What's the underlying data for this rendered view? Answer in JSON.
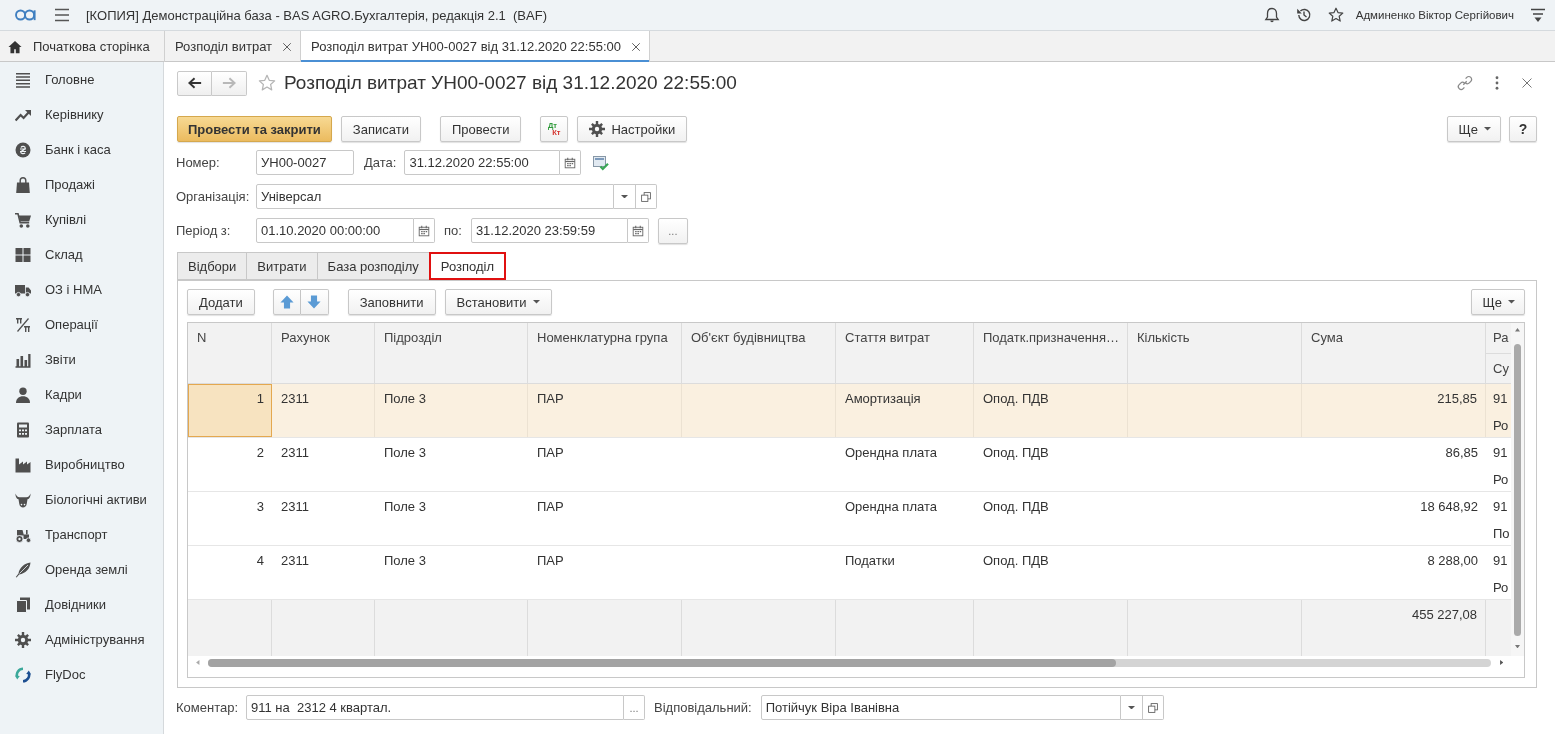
{
  "app_bar": {
    "title": "[КОПИЯ] Демонстраційна база - BAS AGRO.Бухгалтерія, редакція 2.1  (BAF)",
    "user": "Админенко Віктор Сергійович"
  },
  "open_tabs": [
    {
      "label": "Початкова сторінка",
      "kind": "home",
      "selected": false
    },
    {
      "label": "Розподіл витрат",
      "kind": "document",
      "selected": false
    },
    {
      "label": "Розподіл витрат УН00-0027 від 31.12.2020 22:55:00",
      "kind": "document",
      "selected": true
    }
  ],
  "sidebar": {
    "items": [
      {
        "label": "Головне"
      },
      {
        "label": "Керівнику"
      },
      {
        "label": "Банк і каса"
      },
      {
        "label": "Продажі"
      },
      {
        "label": "Купівлі"
      },
      {
        "label": "Склад"
      },
      {
        "label": "ОЗ і НМА"
      },
      {
        "label": "Операції"
      },
      {
        "label": "Звіти"
      },
      {
        "label": "Кадри"
      },
      {
        "label": "Зарплата"
      },
      {
        "label": "Виробництво"
      },
      {
        "label": "Біологічні активи"
      },
      {
        "label": "Транспорт"
      },
      {
        "label": "Оренда землі"
      },
      {
        "label": "Довідники"
      },
      {
        "label": "Адміністрування"
      },
      {
        "label": "FlyDoc"
      }
    ]
  },
  "document": {
    "navigation": [
      {
        "kind": "back",
        "disabled": false
      },
      {
        "kind": "forward",
        "disabled": true
      }
    ],
    "title": "Розподіл витрат УН00-0027 від 31.12.2020 22:55:00"
  },
  "toolbar": {
    "buttons": [
      {
        "label": "Провести та закрити",
        "kind": "primary"
      },
      {
        "label": "Записати",
        "kind": "plain"
      },
      {
        "label": "Провести",
        "kind": "plain"
      },
      {
        "kind": "debit_credit",
        "debit": "Дт",
        "credit": "Кт"
      },
      {
        "label": "Настройки",
        "kind": "settings"
      }
    ],
    "right": [
      {
        "label": "Ще",
        "kind": "menu"
      },
      {
        "label": "?",
        "kind": "plain"
      }
    ]
  },
  "form": {
    "number": {
      "label": "Номер:",
      "value": "УН00-0027"
    },
    "date": {
      "label": "Дата:",
      "value": "31.12.2020 22:55:00"
    },
    "organization": {
      "label": "Організація:",
      "value": "Універсал"
    },
    "period_from": {
      "label": "Період з:",
      "value": "01.10.2020 00:00:00"
    },
    "period_to": {
      "label": "по:",
      "value": "31.12.2020 23:59:59"
    },
    "period_button": "..."
  },
  "form_tabs": [
    {
      "label": "Відбори",
      "selected": false,
      "highlighted": false
    },
    {
      "label": "Витрати",
      "selected": false,
      "highlighted": false
    },
    {
      "label": "База розподілу",
      "selected": false,
      "highlighted": false
    },
    {
      "label": "Розподіл",
      "selected": true,
      "highlighted": true
    }
  ],
  "table_toolbar": {
    "buttons": [
      {
        "label": "Додати",
        "kind": "plain"
      },
      {
        "kind": "move_up"
      },
      {
        "kind": "move_down"
      },
      {
        "label": "Заповнити",
        "kind": "plain"
      },
      {
        "label": "Встановити",
        "kind": "menu"
      }
    ],
    "right": [
      {
        "label": "Ще",
        "kind": "menu"
      }
    ]
  },
  "table": {
    "columns": [
      {
        "label": "N",
        "kind": "number"
      },
      {
        "label": "Рахунок",
        "kind": "text"
      },
      {
        "label": "Підрозділ",
        "kind": "text"
      },
      {
        "label": "Номенклатурна група",
        "kind": "text"
      },
      {
        "label": "Об'єкт будівництва",
        "kind": "text"
      },
      {
        "label": "Стаття витрат",
        "kind": "text"
      },
      {
        "label": "Податк.призначення…",
        "kind": "text"
      },
      {
        "label": "Кількість",
        "kind": "number"
      },
      {
        "label": "Сума",
        "kind": "number"
      },
      {
        "label": "Ра",
        "sublabel": "Су",
        "kind": "split"
      }
    ],
    "rows": [
      {
        "selected": true,
        "n": "1",
        "account": "2311",
        "subdivision": "Поле 3",
        "item_group": "ПАР",
        "cost_item": "Амортизація",
        "tax_purpose": "Опод. ПДВ",
        "amount": "215,85",
        "column_10": [
          "91",
          "Ро"
        ]
      },
      {
        "selected": false,
        "n": "2",
        "account": "2311",
        "subdivision": "Поле 3",
        "item_group": "ПАР",
        "cost_item": "Орендна плата",
        "tax_purpose": "Опод. ПДВ",
        "amount": "86,85",
        "column_10": [
          "91",
          "Ро"
        ]
      },
      {
        "selected": false,
        "n": "3",
        "account": "2311",
        "subdivision": "Поле 3",
        "item_group": "ПАР",
        "cost_item": "Орендна плата",
        "tax_purpose": "Опод. ПДВ",
        "amount": "18 648,92",
        "column_10": [
          "91",
          "По"
        ]
      },
      {
        "selected": false,
        "n": "4",
        "account": "2311",
        "subdivision": "Поле 3",
        "item_group": "ПАР",
        "cost_item": "Податки",
        "tax_purpose": "Опод. ПДВ",
        "amount": "8 288,00",
        "column_10": [
          "91",
          "Ро"
        ]
      }
    ],
    "totals": {
      "amount": "455 227,08"
    }
  },
  "footer": {
    "comment": {
      "label": "Коментар:",
      "value": "911 на  2312 4 квартал.",
      "button": "..."
    },
    "responsible": {
      "label": "Відповідальний:",
      "value": "Потійчук Віра Іванівна"
    }
  }
}
